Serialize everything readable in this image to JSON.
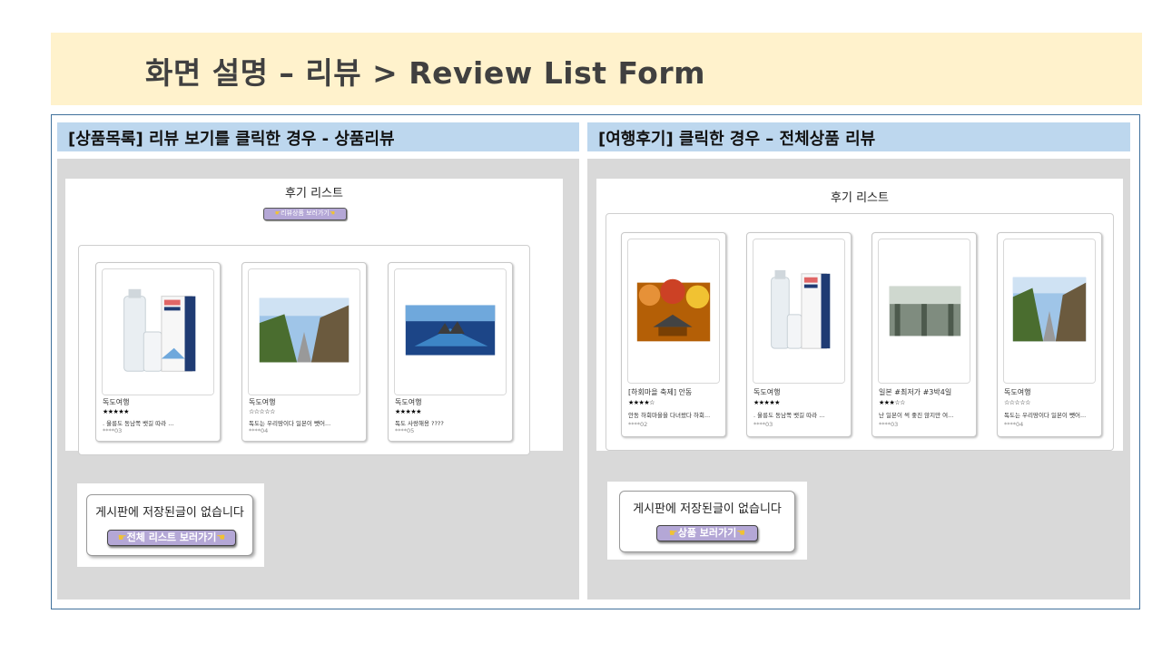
{
  "slide": {
    "title": "화면 설명 – 리뷰 > Review List Form"
  },
  "left_panel": {
    "header": "[상품목록] 리뷰 보기를 클릭한 경우 - 상품리뷰",
    "screen_title": "후기 리스트",
    "button_label": "리뷰상품 보러가기",
    "cards": [
      {
        "title": "독도여행",
        "stars": "★★★★★",
        "body": ". 울릉도 동남쪽 뱃길 따라 ...",
        "user": "****03",
        "image": "product-package-image"
      },
      {
        "title": "독도여행",
        "stars": "☆☆☆☆☆",
        "body": "독도는 우리땅이다 일본이 뺏어...",
        "user": "****04",
        "image": "coastal-stairs-photo"
      },
      {
        "title": "독도여행",
        "stars": "★★★★★",
        "body": "독도 사랑해용 ????",
        "user": "****05",
        "image": "dokdo-island-photo"
      }
    ],
    "empty_message": "게시판에 저장된글이 없습니다",
    "empty_button": "전체 리스트 보러가기"
  },
  "right_panel": {
    "header": "[여행후기] 클릭한 경우 – 전체상품 리뷰",
    "screen_title": "후기 리스트",
    "cards": [
      {
        "title": "[하회마을 축제] 안동",
        "stars": "★★★★☆",
        "body": "안동 하회마을을 다녀왔다 하회...",
        "user": "****02",
        "image": "autumn-village-photo"
      },
      {
        "title": "독도여행",
        "stars": "★★★★★",
        "body": ". 울릉도 동남쪽 뱃길 따라 ...",
        "user": "****03",
        "image": "product-package-image"
      },
      {
        "title": "일본 #최저가 #3박4일",
        "stars": "★★★☆☆",
        "body": "난 일본이 썩 좋진 않지만 여...",
        "user": "****03",
        "image": "airport-terminal-photo"
      },
      {
        "title": "독도여행",
        "stars": "☆☆☆☆☆",
        "body": "독도는 우리땅이다 일본이 뺏어...",
        "user": "****04",
        "image": "coastal-stairs-photo"
      }
    ],
    "empty_message": "게시판에 저장된글이 없습니다",
    "empty_button": "상품 보러가기"
  },
  "colors": {
    "title_band": "#fff2cc",
    "panel_header": "#bdd7ee",
    "panel_background": "#d9d9d9",
    "button": "#b4a7d6"
  }
}
